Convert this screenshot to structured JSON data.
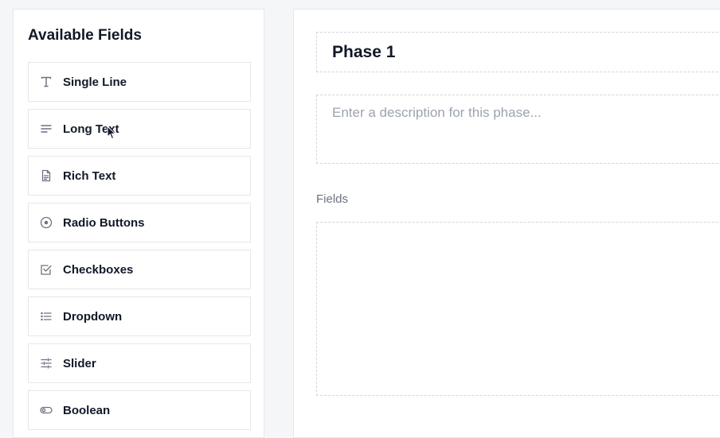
{
  "sidebar": {
    "title": "Available Fields",
    "items": [
      {
        "label": "Single Line",
        "icon": "text-t-icon"
      },
      {
        "label": "Long Text",
        "icon": "align-left-icon"
      },
      {
        "label": "Rich Text",
        "icon": "document-icon"
      },
      {
        "label": "Radio Buttons",
        "icon": "radio-icon"
      },
      {
        "label": "Checkboxes",
        "icon": "checkbox-icon"
      },
      {
        "label": "Dropdown",
        "icon": "list-icon"
      },
      {
        "label": "Slider",
        "icon": "sliders-icon"
      },
      {
        "label": "Boolean",
        "icon": "toggle-icon"
      }
    ]
  },
  "phase": {
    "title": "Phase 1",
    "description_value": "",
    "description_placeholder": "Enter a description for this phase...",
    "fields_label": "Fields"
  },
  "colors": {
    "background": "#f5f6f8",
    "panel": "#ffffff",
    "border": "#e5e7eb",
    "dashed_border": "#d1d5db",
    "text": "#111827",
    "muted": "#6b7280",
    "placeholder": "#9ca3af"
  }
}
